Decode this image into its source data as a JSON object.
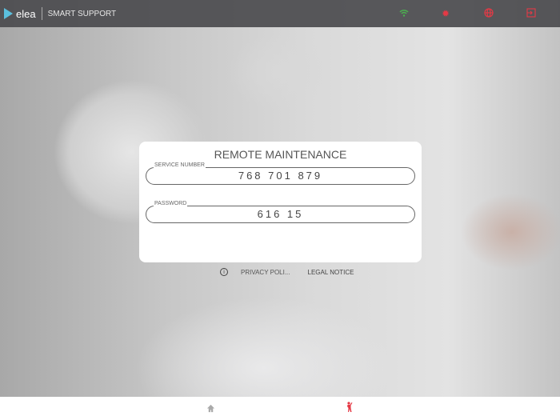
{
  "header": {
    "brand": "elea",
    "app_title": "SMART SUPPORT",
    "icons": [
      "wifi-icon",
      "gear-icon",
      "globe-icon",
      "logout-icon"
    ],
    "wifi_color": "#4caf50",
    "accent": "#e53945"
  },
  "card": {
    "title": "REMOTE MAINTENANCE",
    "service_label": "SERVICE NUMBER",
    "service_value": "768 701 879",
    "password_label": "PASSWORD",
    "password_value": "616 15"
  },
  "footer_links": {
    "privacy": "PRIVACY POLI...",
    "legal": "LEGAL NOTICE"
  },
  "bottom_nav": [
    "home-icon",
    "support-person-icon"
  ]
}
